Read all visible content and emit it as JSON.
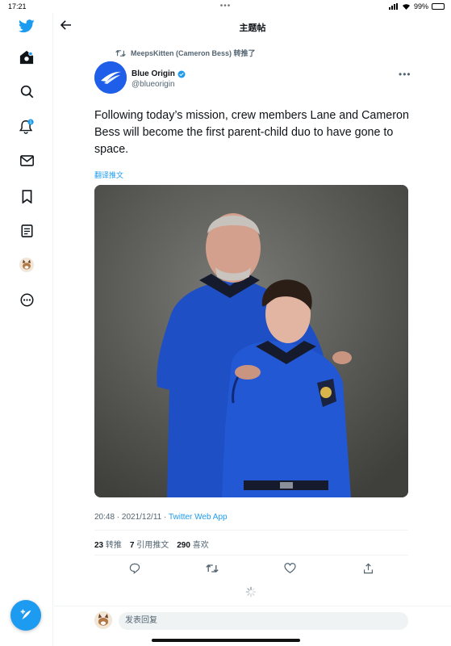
{
  "status_bar": {
    "time": "17:21",
    "battery_percent": "99%"
  },
  "header": {
    "title": "主题帖"
  },
  "retweet": {
    "text": "MeepsKitten (Cameron Bess) 转推了"
  },
  "author": {
    "name": "Blue Origin",
    "handle": "@blueorigin",
    "verified": true
  },
  "tweet": {
    "text": "Following today’s mission, crew members Lane and Cameron Bess will become the first parent-child duo to have gone to space.",
    "translate_label": "翻译推文",
    "timestamp": "20:48 · 2021/12/11 · ",
    "app": "Twitter Web App"
  },
  "stats": {
    "retweets": "23",
    "retweets_label": "转推",
    "quotes": "7",
    "quotes_label": "引用推文",
    "likes": "290",
    "likes_label": "喜欢"
  },
  "reply": {
    "placeholder": "发表回复"
  },
  "notifications_badge": "1",
  "colors": {
    "accent": "#1d9bf0",
    "blue_origin_avatar": "#1f5ee8",
    "text": "#0f1419",
    "secondary": "#536471"
  },
  "icons": [
    "twitter-logo-icon",
    "home-icon",
    "search-icon",
    "bell-icon",
    "mail-icon",
    "bookmark-icon",
    "list-icon",
    "more-circle-icon",
    "compose-icon",
    "back-arrow-icon",
    "retweet-icon",
    "verified-icon",
    "reply-icon",
    "like-icon",
    "share-icon",
    "loading-spinner-icon"
  ]
}
